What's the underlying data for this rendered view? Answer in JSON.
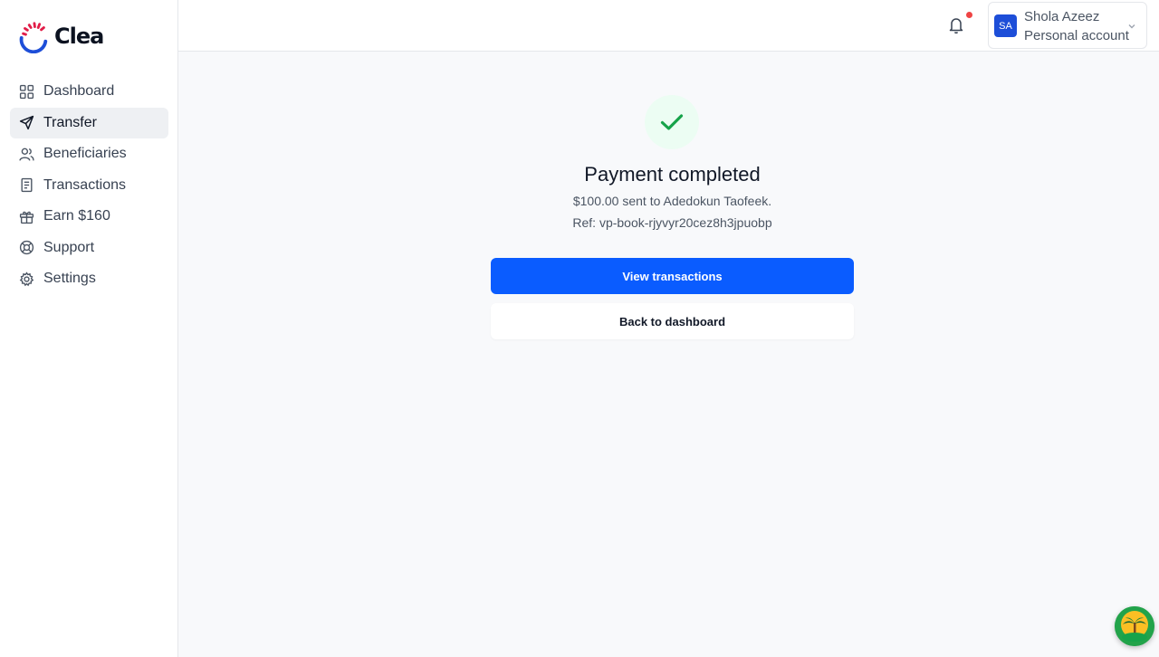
{
  "brand": {
    "name": "Clea"
  },
  "sidebar": {
    "items": [
      {
        "label": "Dashboard",
        "icon": "grid-icon"
      },
      {
        "label": "Transfer",
        "icon": "send-icon",
        "active": true
      },
      {
        "label": "Beneficiaries",
        "icon": "users-icon"
      },
      {
        "label": "Transactions",
        "icon": "receipt-icon"
      },
      {
        "label": "Earn $160",
        "icon": "gift-icon"
      },
      {
        "label": "Support",
        "icon": "lifebuoy-icon"
      },
      {
        "label": "Settings",
        "icon": "gear-icon"
      }
    ]
  },
  "header": {
    "notifications": {
      "icon": "bell-icon",
      "has_unread": true
    },
    "account": {
      "initials": "SA",
      "name": "Shola Azeez",
      "type": "Personal account"
    }
  },
  "result": {
    "status_icon": "check-icon",
    "title": "Payment completed",
    "summary": "$100.00 sent to Adedokun Taofeek.",
    "reference": "Ref: vp-book-rjyvyr20cez8h3jpuobp",
    "primary_button": "View transactions",
    "secondary_button": "Back to dashboard"
  },
  "chat_widget": {
    "icon": "chat-launcher-icon"
  },
  "colors": {
    "primary": "#0a5cff",
    "success": "#16a34a",
    "badge": "#ef4444",
    "avatar": "#1d4ed8"
  }
}
